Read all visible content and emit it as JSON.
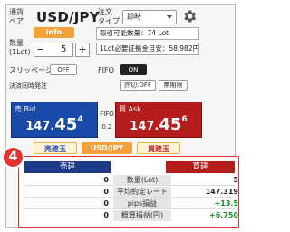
{
  "header": {
    "pair_label_1": "通貨",
    "pair_label_2": "ペア",
    "pair": "USD/JPY",
    "info_button": "info",
    "order_type_label_1": "注文",
    "order_type_label_2": "タイプ",
    "order_type_value": "即時"
  },
  "quantity": {
    "label_1": "数量",
    "label_2": "(1Lot)",
    "minus": "−",
    "value": "5",
    "plus": "+"
  },
  "account": {
    "tradable_lot": "取引可能数量：74 Lot",
    "required_margin": "1Lot必要証拠金目安：58,982円"
  },
  "settings": {
    "slippage_label": "スリッページ",
    "slippage_value": "OFF",
    "fifo_label": "FIFO",
    "fifo_value": "ON",
    "settlement_label": "決済同時発注",
    "trail_button": "許切:OFF",
    "no_limit_button": "無期限"
  },
  "prices": {
    "bid_label": "売 Bid",
    "bid_main": "147.",
    "bid_big": "45",
    "bid_small": "4",
    "fifo_top": "FIFO",
    "spread": "0.2",
    "ask_label": "買 Ask",
    "ask_main": "147.",
    "ask_big": "45",
    "ask_small": "6"
  },
  "actions": {
    "sell_settle": "売建玉",
    "pair_button": "USD/JPY",
    "buy_settle": "買建玉"
  },
  "positions": {
    "badge": "4",
    "sell_header": "売建",
    "buy_header": "買建",
    "rows": [
      {
        "sell": "0",
        "label": "数量(Lot)",
        "buy": "5"
      },
      {
        "sell": "0",
        "label": "平均約定レート",
        "buy": "147.319"
      },
      {
        "sell": "0",
        "label": "pips損益",
        "buy": "+13.5"
      },
      {
        "sell": "0",
        "label": "概算損益(円)",
        "buy": "+6,750"
      }
    ]
  },
  "colors": {
    "bid_blue": "#1a4aa8",
    "ask_red": "#b51d1d",
    "accent_orange": "#f3a23a",
    "profit_green": "#1a8b2a",
    "highlight_red": "#e5322c"
  }
}
